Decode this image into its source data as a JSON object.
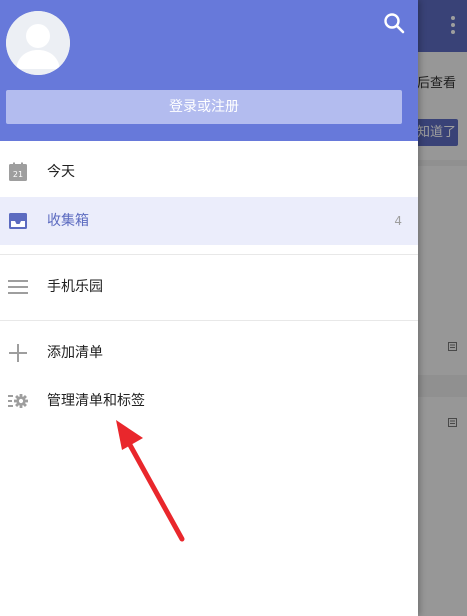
{
  "colors": {
    "primary": "#5c6bc0",
    "header_bg": "#6779da",
    "login_bg": "#b3bcef",
    "active_bg": "#ebedfb",
    "icon_gray": "#9e9e9e",
    "arrow_red": "#e9272c"
  },
  "background": {
    "banner_text": "后查看",
    "banner_button": "知道了"
  },
  "drawer": {
    "search_icon": "search-icon",
    "login_label": "登录或注册",
    "calendar_day": "21",
    "items": [
      {
        "label": "今天",
        "icon": "calendar-icon"
      },
      {
        "label": "收集箱",
        "icon": "inbox-icon",
        "count": "4",
        "active": true
      },
      {
        "label": "手机乐园",
        "icon": "list-icon"
      },
      {
        "label": "添加清单",
        "icon": "plus-icon"
      },
      {
        "label": "管理清单和标签",
        "icon": "manage-gear-icon"
      }
    ]
  }
}
